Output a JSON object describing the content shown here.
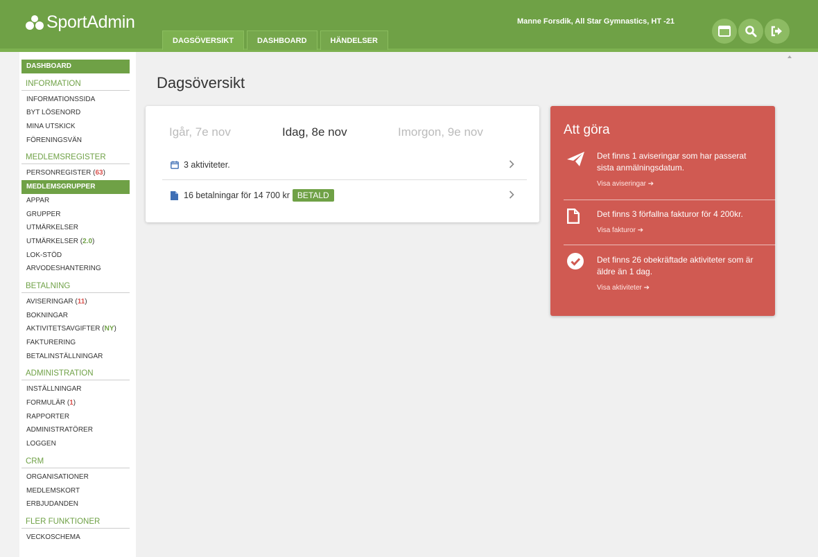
{
  "header": {
    "logo_text": "SportAdmin",
    "user_info": "Manne Forsdik, All Star Gymnastics, HT -21",
    "tabs": [
      {
        "label": "DAGSÖVERSIKT"
      },
      {
        "label": "DASHBOARD"
      },
      {
        "label": "HÄNDELSER"
      }
    ]
  },
  "sidebar": {
    "dashboard": "DASHBOARD",
    "information": {
      "title": "INFORMATION",
      "items": [
        "INFORMATIONSSIDA",
        "BYT LÖSENORD",
        "MINA UTSKICK",
        "FÖRENINGSVÄN"
      ]
    },
    "medlemsregister": {
      "title": "MEDLEMSREGISTER",
      "personregister": "PERSONREGISTER",
      "personregister_count": "63",
      "medlemsgrupper": "MEDLEMSGRUPPER",
      "items": [
        "APPAR",
        "GRUPPER",
        "UTMÄRKELSER"
      ],
      "utmarkelser2": "UTMÄRKELSER",
      "utmarkelser2_version": "2.0",
      "items2": [
        "LOK-STÖD",
        "ARVODESHANTERING"
      ]
    },
    "betalning": {
      "title": "BETALNING",
      "aviseringar": "AVISERINGAR",
      "aviseringar_count": "11",
      "bokningar": "BOKNINGAR",
      "aktivitetsavgifter": "AKTIVITETSAVGIFTER",
      "aktivitetsavgifter_tag": "NY",
      "items": [
        "FAKTURERING",
        "BETALINSTÄLLNINGAR"
      ]
    },
    "administration": {
      "title": "ADMINISTRATION",
      "installningar": "INSTÄLLNINGAR",
      "formular": "FORMULÄR",
      "formular_count": "1",
      "items": [
        "RAPPORTER",
        "ADMINISTRATÖRER",
        "LOGGEN"
      ]
    },
    "crm": {
      "title": "CRM",
      "items": [
        "ORGANISATIONER",
        "MEDLEMSKORT",
        "ERBJUDANDEN"
      ]
    },
    "fler": {
      "title": "FLER FUNKTIONER",
      "items": [
        "VECKOSCHEMA"
      ]
    }
  },
  "main": {
    "title": "Dagsöversikt",
    "days": {
      "prev": "Igår, 7e nov",
      "today": "Idag, 8e nov",
      "next": "Imorgon, 9e nov"
    },
    "activities": "3 aktiviteter.",
    "payments": "16 betalningar för 14 700 kr",
    "payments_status": "BETALD"
  },
  "todo": {
    "title": "Att göra",
    "items": [
      {
        "text": "Det finns 1 aviseringar som har passerat sista anmälningsdatum.",
        "link": "Visa aviseringar"
      },
      {
        "text": "Det finns 3 förfallna fakturor för 4 200kr.",
        "link": "Visa fakturor"
      },
      {
        "text": "Det finns 26 obekräftade aktiviteter som är äldre än 1 dag.",
        "link": "Visa aktiviteter"
      }
    ]
  },
  "colors": {
    "brand_green": "#6fa146",
    "todo_red": "#d05a52"
  }
}
